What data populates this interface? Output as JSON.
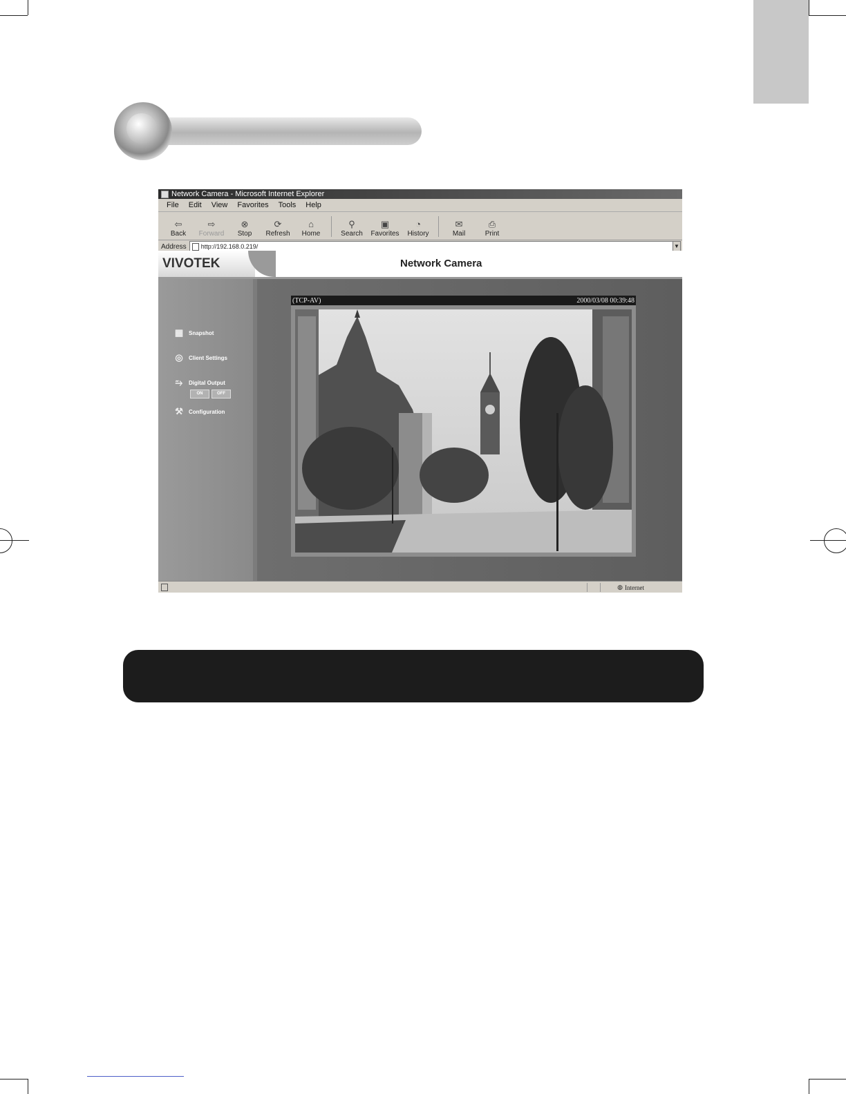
{
  "browser": {
    "window_title": "Network Camera - Microsoft Internet Explorer",
    "menu": [
      "File",
      "Edit",
      "View",
      "Favorites",
      "Tools",
      "Help"
    ],
    "toolbar": {
      "back": "Back",
      "forward": "Forward",
      "stop": "Stop",
      "refresh": "Refresh",
      "home": "Home",
      "search": "Search",
      "favorites": "Favorites",
      "history": "History",
      "mail": "Mail",
      "print": "Print"
    },
    "address_label": "Address",
    "address_value": "http://192.168.0.219/",
    "status_zone": "Internet"
  },
  "page": {
    "logo": "VIVOTEK",
    "title": "Network Camera",
    "sidebar": {
      "snapshot": "Snapshot",
      "client_settings": "Client Settings",
      "digital_output": "Digital Output",
      "on": "ON",
      "off": "OFF",
      "configuration": "Configuration"
    },
    "video": {
      "mode": "(TCP-AV)",
      "timestamp": "2000/03/08 00:39:48"
    }
  }
}
